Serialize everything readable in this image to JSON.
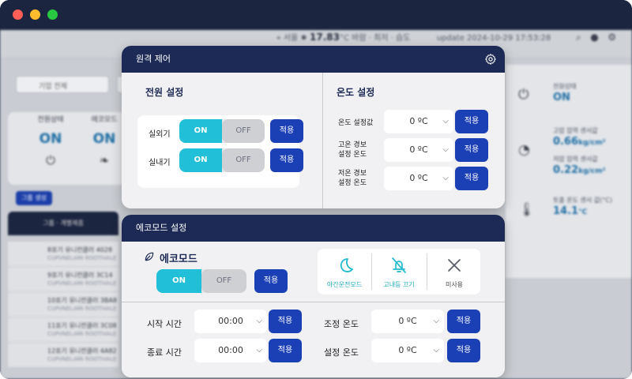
{
  "window": {
    "colors": {
      "close": "#ff5f57",
      "minimize": "#febc2e",
      "maximize": "#28c840"
    }
  },
  "background": {
    "weather": {
      "location": "서울",
      "temperature": "17.83",
      "unit": "°C",
      "desc": "바람 · 최저 · 습도",
      "datetime": "update 2024-10-29 17:53:28"
    },
    "group_select": "기업 전체",
    "status": [
      {
        "label": "전원상태",
        "value": "ON",
        "icon": "power-icon"
      },
      {
        "label": "에코모드",
        "value": "ON",
        "icon": "leaf-icon"
      }
    ],
    "group_button": "그룹 생성",
    "table_header": "그룹 · 개별제품",
    "rows": [
      {
        "name": "8호기 유니컨클러 4028",
        "sub": "CUPVNELAMI ROOTIVALE"
      },
      {
        "name": "9호기 유니컨클러 3C14",
        "sub": "CUPVNELAMI ROOTIVALE"
      },
      {
        "name": "10호기 유니컨클러 3BA8",
        "sub": "CUPVNELAMI ROOTIVALE"
      },
      {
        "name": "11호기 유니컨클러 3C08",
        "sub": "CUPVNELAMI ROOTIVALE"
      },
      {
        "name": "12호기 유니컨클러 4A82",
        "sub": "CUPVNELAMI ROOTIVALE"
      }
    ],
    "right_stats": [
      {
        "label": "전원상태",
        "value": "ON",
        "unit": "",
        "icon": "power-icon"
      },
      {
        "label": "고압 압력 센서값",
        "value": "0.66",
        "unit": "kg/cm²",
        "icon": "gauge-icon"
      },
      {
        "label": "저압 압력 센서값",
        "value": "0.22",
        "unit": "kg/cm²",
        "icon": ""
      },
      {
        "label": "토출 온도 센서 값(°C)",
        "value": "14.1",
        "unit": "°C",
        "icon": "thermometer-icon"
      }
    ]
  },
  "remote": {
    "title": "원격 제어",
    "power": {
      "title": "전원 설정",
      "rows": [
        {
          "label": "실외기",
          "on": "ON",
          "off": "OFF",
          "apply": "적용"
        },
        {
          "label": "실내기",
          "on": "ON",
          "off": "OFF",
          "apply": "적용"
        }
      ]
    },
    "temp": {
      "title": "온도 설정",
      "rows": [
        {
          "label": "온도 설정값",
          "value": "0 ºC",
          "apply": "적용"
        },
        {
          "label": "고온 경보\n설정 온도",
          "value": "0 ºC",
          "apply": "적용"
        },
        {
          "label": "저온 경보\n설정 온도",
          "value": "0 ºC",
          "apply": "적용"
        }
      ]
    }
  },
  "eco": {
    "title": "에코모드 설정",
    "mode_title": "에코모드",
    "on": "ON",
    "off": "OFF",
    "apply": "적용",
    "modes": [
      {
        "label": "야간운전모드",
        "icon": "moon-icon",
        "active": true
      },
      {
        "label": "고내등 끄기",
        "icon": "bell-off-icon",
        "active": true
      },
      {
        "label": "미사용",
        "icon": "close-icon",
        "active": false
      }
    ],
    "start": {
      "label": "시작 시간",
      "value": "00:00",
      "apply": "적용"
    },
    "end": {
      "label": "종료 시간",
      "value": "00:00",
      "apply": "적용"
    },
    "adjust": {
      "label": "조정 온도",
      "value": "0 ºC",
      "apply": "적용"
    },
    "setting": {
      "label": "설정 온도",
      "value": "0 ºC",
      "apply": "적용"
    }
  },
  "colors": {
    "header": "#1c2a55",
    "apply": "#1b3fb5",
    "toggle_on": "#22c0d8",
    "accent_icon": "#22b9cf"
  }
}
